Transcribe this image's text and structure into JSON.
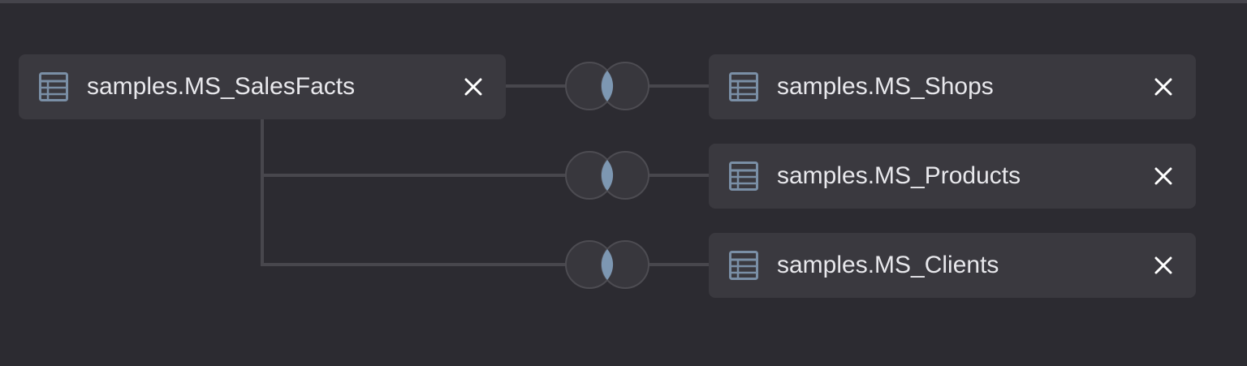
{
  "colors": {
    "background": "#2c2b31",
    "card": "#3a393f",
    "connector": "#48474d",
    "join_circle": "#38373d",
    "join_overlap": "#7d97b2",
    "icon": "#7a8fa6",
    "text": "#e8e8ec"
  },
  "source_table": {
    "name": "samples.MS_SalesFacts",
    "icon": "table-icon",
    "remove_icon": "close-icon"
  },
  "joined_tables": [
    {
      "name": "samples.MS_Shops",
      "icon": "table-icon",
      "remove_icon": "close-icon",
      "join_type": "inner-join-icon"
    },
    {
      "name": "samples.MS_Products",
      "icon": "table-icon",
      "remove_icon": "close-icon",
      "join_type": "inner-join-icon"
    },
    {
      "name": "samples.MS_Clients",
      "icon": "table-icon",
      "remove_icon": "close-icon",
      "join_type": "inner-join-icon"
    }
  ]
}
